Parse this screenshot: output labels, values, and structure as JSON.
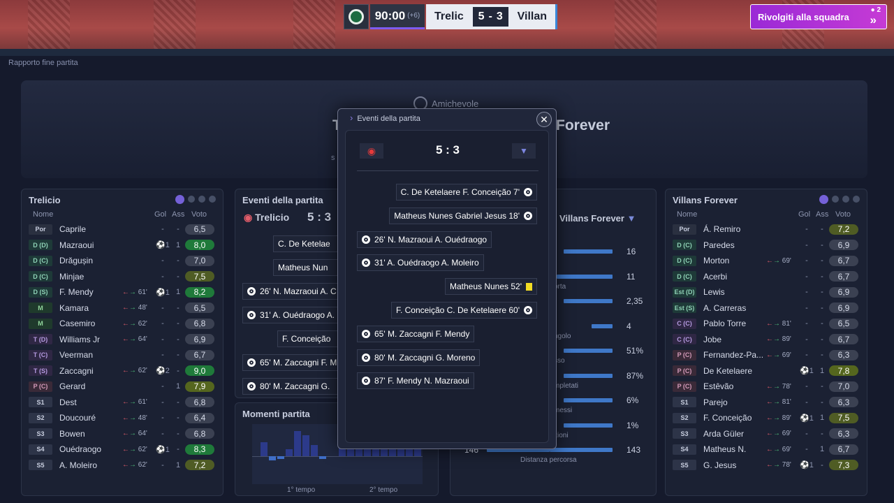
{
  "scorebar": {
    "time": "90:00",
    "added": "(+6)",
    "home": "Trelic",
    "home_score": "5",
    "sep": "-",
    "away_score": "3",
    "away": "Villan"
  },
  "team_talk": {
    "label": "Rivolgiti alla squadra",
    "badge": "2"
  },
  "breadcrumb": "Rapporto fine partita",
  "header": {
    "competition": "Amichevole",
    "home_partial": "T",
    "away_partial": "Forever",
    "subtext_partial": "s"
  },
  "home_panel": {
    "title": "Trelicio",
    "cols": {
      "name": "Nome",
      "gol": "Gol",
      "ass": "Ass",
      "voto": "Voto"
    },
    "players": [
      {
        "pos": "Por",
        "cls": "g",
        "name": "Caprile",
        "sub": "",
        "gol": "-",
        "ass": "-",
        "voto": "6,5",
        "vc": "low"
      },
      {
        "pos": "D (D)",
        "cls": "d",
        "name": "Mazraoui",
        "sub": "",
        "gol": "⚽1",
        "ass": "1",
        "voto": "8,0",
        "vc": "hi"
      },
      {
        "pos": "D (C)",
        "cls": "d",
        "name": "Drăgușin",
        "sub": "",
        "gol": "-",
        "ass": "-",
        "voto": "7,0",
        "vc": "low"
      },
      {
        "pos": "D (C)",
        "cls": "d",
        "name": "Minjae",
        "sub": "",
        "gol": "-",
        "ass": "-",
        "voto": "7,5",
        "vc": "y"
      },
      {
        "pos": "D (S)",
        "cls": "d",
        "name": "F. Mendy",
        "sub": "61'",
        "gol": "⚽1",
        "ass": "1",
        "voto": "8,2",
        "vc": "hi"
      },
      {
        "pos": "M",
        "cls": "m",
        "name": "Kamara",
        "sub": "48'",
        "gol": "-",
        "ass": "-",
        "voto": "6,5",
        "vc": "low"
      },
      {
        "pos": "M",
        "cls": "m",
        "name": "Casemiro",
        "sub": "62'",
        "gol": "-",
        "ass": "-",
        "voto": "6,8",
        "vc": "low"
      },
      {
        "pos": "T (D)",
        "cls": "t",
        "name": "Williams Jr",
        "sub": "64'",
        "gol": "-",
        "ass": "-",
        "voto": "6,9",
        "vc": "low"
      },
      {
        "pos": "T (C)",
        "cls": "t",
        "name": "Veerman",
        "sub": "",
        "gol": "-",
        "ass": "-",
        "voto": "6,7",
        "vc": "low"
      },
      {
        "pos": "T (S)",
        "cls": "t",
        "name": "Zaccagni",
        "sub": "62'",
        "gol": "⚽2",
        "ass": "-",
        "voto": "9,0",
        "vc": "hi"
      },
      {
        "pos": "P (C)",
        "cls": "p",
        "name": "Gerard",
        "sub": "",
        "gol": "-",
        "ass": "1",
        "voto": "7,9",
        "vc": "mid"
      },
      {
        "pos": "S1",
        "cls": "s",
        "name": "Dest",
        "sub": "61'",
        "gol": "-",
        "ass": "-",
        "voto": "6,8",
        "vc": "low"
      },
      {
        "pos": "S2",
        "cls": "s",
        "name": "Doucouré",
        "sub": "48'",
        "gol": "-",
        "ass": "-",
        "voto": "6,4",
        "vc": "low"
      },
      {
        "pos": "S3",
        "cls": "s",
        "name": "Bowen",
        "sub": "64'",
        "gol": "-",
        "ass": "-",
        "voto": "6,8",
        "vc": "low"
      },
      {
        "pos": "S4",
        "cls": "s",
        "name": "Ouédraogo",
        "sub": "62'",
        "gol": "⚽1",
        "ass": "-",
        "voto": "8,3",
        "vc": "hi"
      },
      {
        "pos": "S5",
        "cls": "s",
        "name": "A. Moleiro",
        "sub": "62'",
        "gol": "-",
        "ass": "1",
        "voto": "7,2",
        "vc": "y"
      }
    ]
  },
  "away_panel": {
    "title": "Villans Forever",
    "cols": {
      "name": "Nome",
      "gol": "Gol",
      "ass": "Ass",
      "voto": "Voto"
    },
    "players": [
      {
        "pos": "Por",
        "cls": "g",
        "name": "Á. Remiro",
        "sub": "",
        "gol": "-",
        "ass": "-",
        "voto": "7,2",
        "vc": "y"
      },
      {
        "pos": "D (C)",
        "cls": "d",
        "name": "Paredes",
        "sub": "",
        "gol": "-",
        "ass": "-",
        "voto": "6,9",
        "vc": "low"
      },
      {
        "pos": "D (C)",
        "cls": "d",
        "name": "Morton",
        "sub": "69'",
        "gol": "-",
        "ass": "-",
        "voto": "6,7",
        "vc": "low"
      },
      {
        "pos": "D (C)",
        "cls": "d",
        "name": "Acerbi",
        "sub": "",
        "gol": "-",
        "ass": "-",
        "voto": "6,7",
        "vc": "low"
      },
      {
        "pos": "Est (D)",
        "cls": "d",
        "name": "Lewis",
        "sub": "",
        "gol": "-",
        "ass": "-",
        "voto": "6,9",
        "vc": "low"
      },
      {
        "pos": "Est (S)",
        "cls": "d",
        "name": "A. Carreras",
        "sub": "",
        "gol": "-",
        "ass": "-",
        "voto": "6,9",
        "vc": "low"
      },
      {
        "pos": "C (C)",
        "cls": "t",
        "name": "Pablo Torre",
        "sub": "81'",
        "gol": "-",
        "ass": "-",
        "voto": "6,5",
        "vc": "low"
      },
      {
        "pos": "C (C)",
        "cls": "t",
        "name": "Jobe",
        "sub": "89'",
        "gol": "-",
        "ass": "-",
        "voto": "6,7",
        "vc": "low"
      },
      {
        "pos": "P (C)",
        "cls": "p",
        "name": "Fernandez-Pa...",
        "sub": "69'",
        "gol": "-",
        "ass": "-",
        "voto": "6,3",
        "vc": "low"
      },
      {
        "pos": "P (C)",
        "cls": "p",
        "name": "De Ketelaere",
        "sub": "",
        "gol": "⚽1",
        "ass": "1",
        "voto": "7,8",
        "vc": "mid"
      },
      {
        "pos": "P (C)",
        "cls": "p",
        "name": "Estêvão",
        "sub": "78'",
        "gol": "-",
        "ass": "-",
        "voto": "7,0",
        "vc": "low"
      },
      {
        "pos": "S1",
        "cls": "s",
        "name": "Parejo",
        "sub": "81'",
        "gol": "-",
        "ass": "-",
        "voto": "6,3",
        "vc": "low"
      },
      {
        "pos": "S2",
        "cls": "s",
        "name": "F. Conceição",
        "sub": "89'",
        "gol": "⚽1",
        "ass": "1",
        "voto": "7,5",
        "vc": "y"
      },
      {
        "pos": "S3",
        "cls": "s",
        "name": "Arda Güler",
        "sub": "69'",
        "gol": "-",
        "ass": "-",
        "voto": "6,3",
        "vc": "low"
      },
      {
        "pos": "S4",
        "cls": "s",
        "name": "Matheus N.",
        "sub": "69'",
        "gol": "-",
        "ass": "1",
        "voto": "6,7",
        "vc": "low"
      },
      {
        "pos": "S5",
        "cls": "s",
        "name": "G. Jesus",
        "sub": "78'",
        "gol": "⚽1",
        "ass": "-",
        "voto": "7,3",
        "vc": "y"
      }
    ]
  },
  "mid_events": {
    "title": "Eventi della partita",
    "home": "Trelicio",
    "score": "5 : 3",
    "rows": [
      "C. De Ketelae",
      "Matheus Nun",
      "26' N. Mazraoui A. C",
      "31' A. Ouédraogo A.",
      "F. Conceição",
      "65' M. Zaccagni F. M",
      "80' M. Zaccagni G."
    ]
  },
  "stats": {
    "away": "Villans Forever",
    "rows": [
      {
        "label": "",
        "l": "",
        "r": "16"
      },
      {
        "label": "orta",
        "l": "",
        "r": "11"
      },
      {
        "label": "",
        "l": "",
        "r": "2,35"
      },
      {
        "label": "ngolo",
        "l": "",
        "r": "4"
      },
      {
        "label": "sso",
        "l": "",
        "r": "51%"
      },
      {
        "label": "mpletati",
        "l": "",
        "r": "87%"
      },
      {
        "label": "messi",
        "l": "",
        "r": "6%"
      },
      {
        "label": "zioni",
        "l": "",
        "r": "1%"
      },
      {
        "label": "Distanza percorsa",
        "l": "146",
        "r": "143"
      }
    ]
  },
  "moments": {
    "title": "Momenti partita",
    "first": "1° tempo",
    "second": "2° tempo"
  },
  "modal": {
    "title": "Eventi della partita",
    "score": "5 : 3",
    "events": [
      {
        "side": "away",
        "text": "C. De Ketelaere  F. Conceição  7'",
        "icon": "ball"
      },
      {
        "side": "away",
        "text": "Matheus Nunes  Gabriel Jesus  18'",
        "icon": "ball"
      },
      {
        "side": "home",
        "text": "26'  N. Mazraoui  A. Ouédraogo",
        "icon": "ball"
      },
      {
        "side": "home",
        "text": "31'  A. Ouédraogo  A. Moleiro",
        "icon": "ball"
      },
      {
        "side": "away",
        "text": "Matheus Nunes  52'",
        "icon": "card"
      },
      {
        "side": "away",
        "text": "F. Conceição  C. De Ketelaere  60'",
        "icon": "ball"
      },
      {
        "side": "home",
        "text": "65'  M. Zaccagni  F. Mendy",
        "icon": "ball"
      },
      {
        "side": "home",
        "text": "80'  M. Zaccagni  G. Moreno",
        "icon": "ball"
      },
      {
        "side": "home",
        "text": "87'  F. Mendy  N. Mazraoui",
        "icon": "ball"
      }
    ]
  },
  "colors": {
    "accent": "#7561d8",
    "talk_btn": "#b232d6",
    "good_rating": "#1f7a3a",
    "bar": "#3f78c8"
  }
}
